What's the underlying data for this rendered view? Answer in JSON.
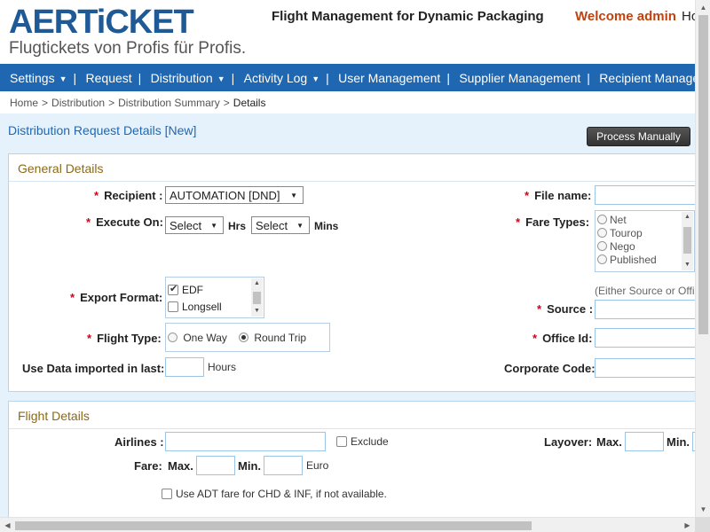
{
  "header": {
    "logo_brand": "AERTiCKET",
    "logo_tagline": "Flugtickets von Profis für Profis.",
    "app_title": "Flight Management for Dynamic Packaging",
    "welcome": "Welcome admin",
    "home_cut": "Ho"
  },
  "nav": {
    "settings": "Settings",
    "request": "Request",
    "distribution": "Distribution",
    "activity_log": "Activity Log",
    "user_management": "User Management",
    "supplier_management": "Supplier Management",
    "recipient_management": "Recipient Management"
  },
  "breadcrumb": {
    "home": "Home",
    "distribution": "Distribution",
    "summary": "Distribution Summary",
    "current": "Details",
    "sep": ">"
  },
  "page": {
    "title": "Distribution Request Details [New]",
    "process_button": "Process Manually"
  },
  "general": {
    "section_title": "General Details",
    "required_mark": "*",
    "recipient_label": "Recipient :",
    "recipient_value": "AUTOMATION [DND]",
    "execute_label": "Execute On:",
    "hrs_select": "Select",
    "hrs_label": "Hrs",
    "mins_select": "Select",
    "mins_label": "Mins",
    "export_label": "Export Format:",
    "export_options": [
      {
        "label": "EDF",
        "checked": true
      },
      {
        "label": "Longsell",
        "checked": false
      }
    ],
    "flight_type_label": "Flight Type:",
    "flight_type_one_way": "One Way",
    "flight_type_round_trip": "Round Trip",
    "flight_type_selected": "Round Trip",
    "use_data_label": "Use Data imported in last:",
    "hours_label": "Hours",
    "file_name_label": "File name:",
    "fare_types_label": "Fare Types:",
    "fare_types": [
      "Net",
      "Tourop",
      "Nego",
      "Published"
    ],
    "either_note": "(Either Source or Offi",
    "source_label": "Source :",
    "office_id_label": "Office Id:",
    "corporate_code_label": "Corporate Code:"
  },
  "flight": {
    "section_title": "Flight Details",
    "airlines_label": "Airlines :",
    "exclude_label": "Exclude",
    "layover_label": "Layover:",
    "layover_max": "Max.",
    "layover_min": "Min.",
    "fare_label": "Fare:",
    "fare_max": "Max.",
    "fare_min": "Min.",
    "currency": "Euro",
    "adt_fare_label": "Use ADT fare for CHD & INF, if not available."
  },
  "colors": {
    "nav_bg": "#1f67b1",
    "brand_blue": "#1f5a96",
    "welcome_orange": "#c0420e",
    "section_title": "#8a6a14",
    "required_red": "#d0021b",
    "content_bg": "#e6f2fb"
  }
}
